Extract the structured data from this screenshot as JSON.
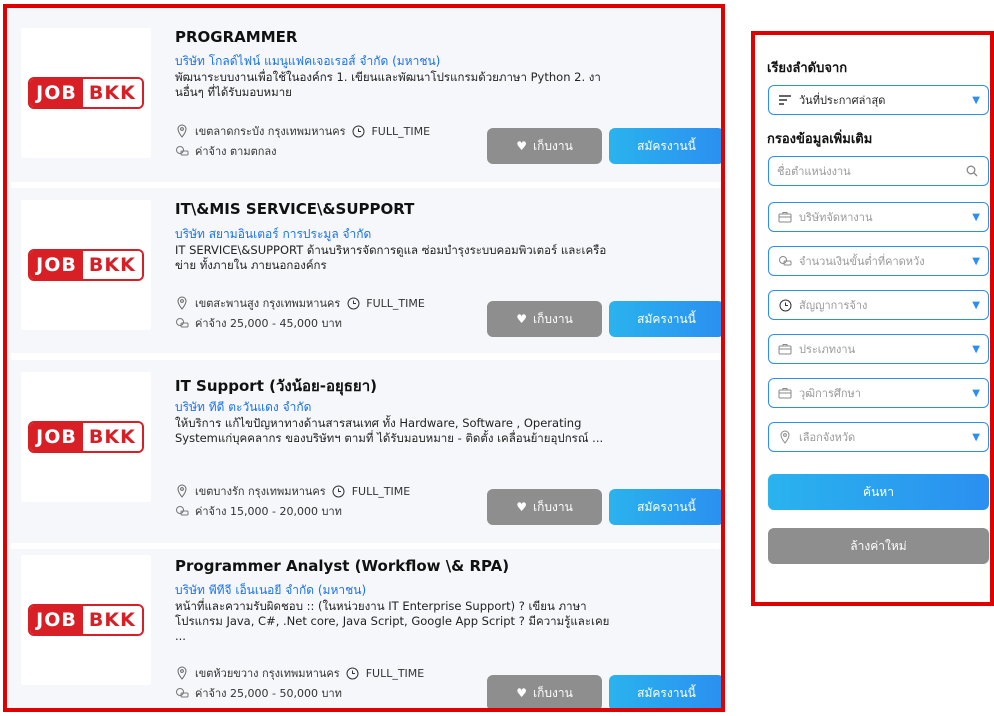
{
  "jobs": [
    {
      "logo": {
        "left": "JOB",
        "right": "BKK"
      },
      "title": "PROGRAMMER",
      "company": "บริษัท โกลด์ไฟน์ แมนูแฟคเจอเรอส์ จำกัด (มหาชน)",
      "description": "พัฒนาระบบงานเพื่อใช้ในองค์กร 1. เขียนและพัฒนาโปรแกรมด้วยภาษา Python 2. งานอื่นๆ ที่ได้รับมอบหมาย",
      "location": "เขตลาดกระบัง กรุงเทพมหานคร",
      "job_type": "FULL_TIME",
      "salary": "ค่าจ้าง ตามตกลง",
      "save_label": "เก็บงาน",
      "apply_label": "สมัครงานนี้"
    },
    {
      "logo": {
        "left": "JOB",
        "right": "BKK"
      },
      "title": "IT\\&MIS SERVICE\\&SUPPORT",
      "company": "บริษัท สยามอินเตอร์ การประมูล จำกัด",
      "description": "IT SERVICE\\&SUPPORT ด้านบริหารจัดการดูแล ซ่อมบำรุงระบบคอมพิวเตอร์ และเครือข่าย ทั้งภายใน ภายนอกองค์กร",
      "location": "เขตสะพานสูง กรุงเทพมหานคร",
      "job_type": "FULL_TIME",
      "salary": "ค่าจ้าง 25,000 - 45,000 บาท",
      "save_label": "เก็บงาน",
      "apply_label": "สมัครงานนี้"
    },
    {
      "logo": {
        "left": "JOB",
        "right": "BKK"
      },
      "title": "IT Support (วังน้อย-อยุธยา)",
      "company": "บริษัท ทีดี ตะวันแดง จำกัด",
      "description": "ให้บริการ แก้ไขปัญหาทางด้านสารสนเทศ ทั้ง Hardware, Software , Operating Systemแก่บุคคลากร ของบริษัทฯ ตามที่ ได้รับมอบหมาย - ติดตั้ง เคลื่อนย้ายอุปกรณ์ ...",
      "location": "เขตบางรัก กรุงเทพมหานคร",
      "job_type": "FULL_TIME",
      "salary": "ค่าจ้าง 15,000 - 20,000 บาท",
      "save_label": "เก็บงาน",
      "apply_label": "สมัครงานนี้"
    },
    {
      "logo": {
        "left": "JOB",
        "right": "BKK"
      },
      "title": "Programmer Analyst (Workflow \\& RPA)",
      "company": "บริษัท พีทีจี เอ็นเนอยี จำกัด (มหาชน)",
      "description": "หน้าที่และความรับผิดชอบ :: (ในหน่วยงาน IT Enterprise Support) ? เขียน ภาษาโปรแกรม Java, C#, .Net core, Java Script, Google App Script ? มีความรู้และเคย ...",
      "location": "เขตห้วยขวาง กรุงเทพมหานคร",
      "job_type": "FULL_TIME",
      "salary": "ค่าจ้าง 25,000 - 50,000 บาท",
      "save_label": "เก็บงาน",
      "apply_label": "สมัครงานนี้"
    }
  ],
  "filter": {
    "sort_heading": "เรียงลำดับจาก",
    "sort_value": "วันที่ประกาศล่าสุด",
    "filter_heading": "กรองข้อมูลเพิ่มเติม",
    "position_placeholder": "ชื่อตำแหน่งงาน",
    "company_placeholder": "บริษัทจัดหางาน",
    "salary_placeholder": "จำนวนเงินขั้นต่ำที่คาดหวัง",
    "contract_placeholder": "สัญญาการจ้าง",
    "jobtype_placeholder": "ประเภทงาน",
    "education_placeholder": "วุฒิการศึกษา",
    "province_placeholder": "เลือกจังหวัด",
    "search_label": "ค้นหา",
    "reset_label": "ล้างค่าใหม่"
  },
  "colors": {
    "highlight": "#e10000",
    "accent": "#2b8ff0",
    "logo_red": "#d81f26"
  }
}
